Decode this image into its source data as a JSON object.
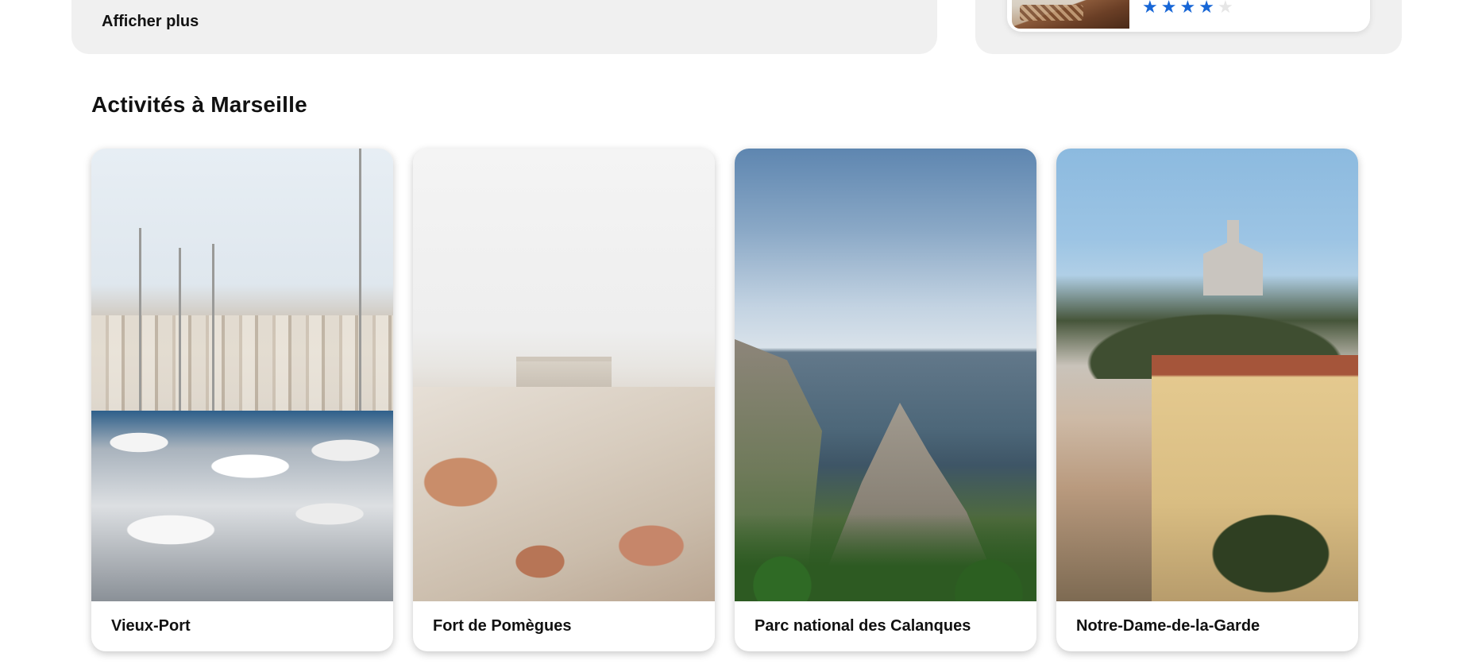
{
  "top_panel": {
    "show_more_label": "Afficher plus"
  },
  "hotel_preview": {
    "rating": 4,
    "max_rating": 5,
    "star_icon": "star-icon",
    "star_color": "#1766d6"
  },
  "activities": {
    "title": "Activités à Marseille",
    "cards": [
      {
        "label": "Vieux-Port",
        "image": "marina-photo"
      },
      {
        "label": "Fort de Pomègues",
        "image": "fort-on-rocks-photo"
      },
      {
        "label": "Parc national des Calanques",
        "image": "calanques-coast-photo"
      },
      {
        "label": "Notre-Dame-de-la-Garde",
        "image": "basilica-on-hill-photo"
      }
    ]
  }
}
